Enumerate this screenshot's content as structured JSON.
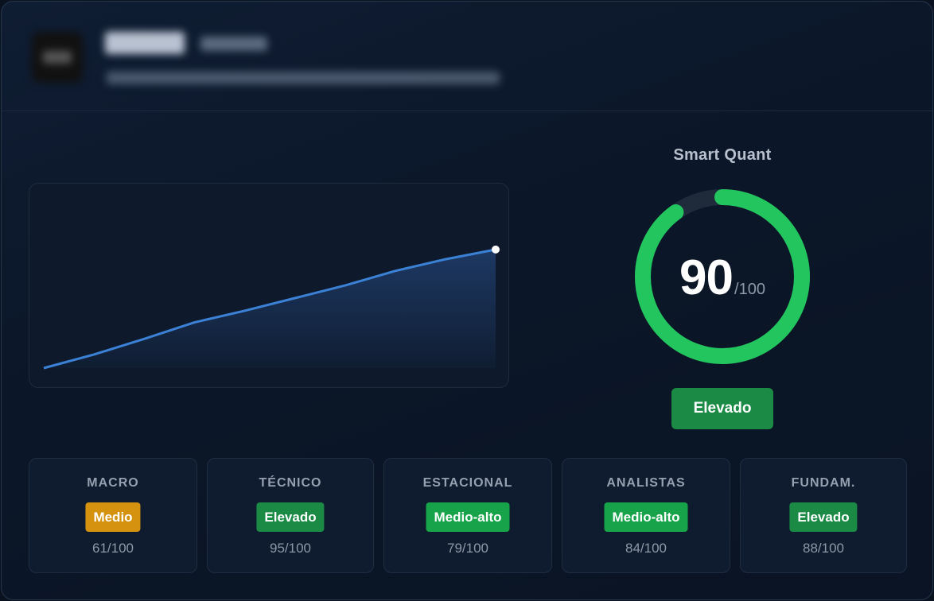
{
  "gauge": {
    "title": "Smart Quant",
    "score": "90",
    "max": "/100",
    "value": 90,
    "max_value": 100,
    "color": "#22c55e",
    "track_color": "#1f2a3a"
  },
  "status": {
    "label": "Elevado",
    "color": "#1a8a45"
  },
  "metrics": [
    {
      "label": "MACRO",
      "badge": "Medio",
      "score": "61/100",
      "color": "#d4920e"
    },
    {
      "label": "TÉCNICO",
      "badge": "Elevado",
      "score": "95/100",
      "color": "#1a8a45"
    },
    {
      "label": "ESTACIONAL",
      "badge": "Medio-alto",
      "score": "79/100",
      "color": "#16a34a"
    },
    {
      "label": "ANALISTAS",
      "badge": "Medio-alto",
      "score": "84/100",
      "color": "#16a34a"
    },
    {
      "label": "FUNDAM.",
      "badge": "Elevado",
      "score": "88/100",
      "color": "#1a8a45"
    }
  ],
  "chart_data": {
    "type": "area",
    "values": [
      0,
      14,
      30,
      47,
      59,
      72,
      85,
      100,
      112,
      122
    ],
    "ylim": [
      0,
      180
    ],
    "line_color": "#3b82d6",
    "fill_color": "#1e3a66"
  }
}
